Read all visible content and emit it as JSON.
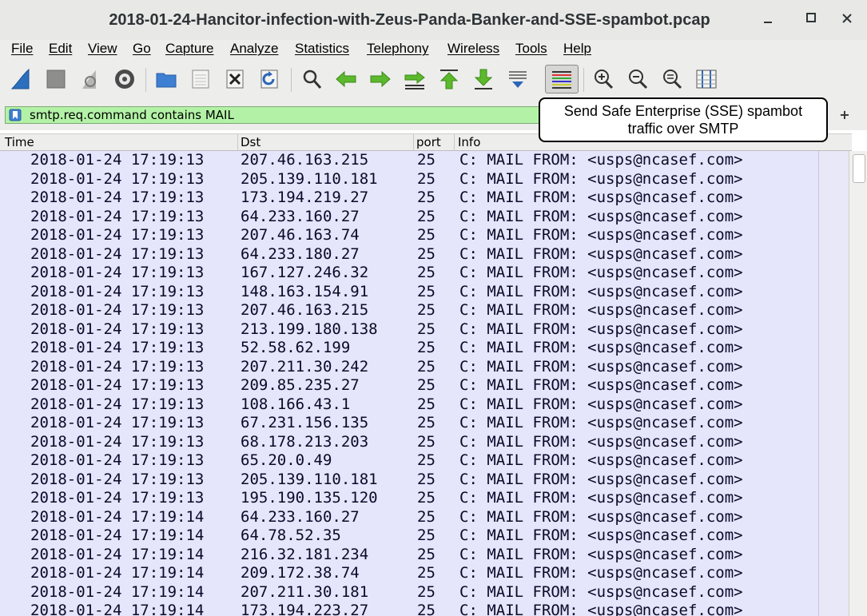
{
  "window": {
    "title": "2018-01-24-Hancitor-infection-with-Zeus-Panda-Banker-and-SSE-spambot.pcap",
    "minimize_label": "_",
    "maximize_label": "■",
    "close_label": "✕"
  },
  "menu": [
    "File",
    "Edit",
    "View",
    "Go",
    "Capture",
    "Analyze",
    "Statistics",
    "Telephony",
    "Wireless",
    "Tools",
    "Help"
  ],
  "toolbar": {
    "icons": [
      "shark-fin-start-icon",
      "stop-capture-icon",
      "restart-capture-icon",
      "capture-options-icon",
      "open-file-icon",
      "save-file-icon",
      "close-file-icon",
      "reload-file-icon",
      "find-packet-icon",
      "go-back-icon",
      "go-forward-icon",
      "go-to-packet-icon",
      "go-first-icon",
      "go-last-icon",
      "autoscroll-icon",
      "colorize-icon",
      "zoom-in-icon",
      "zoom-out-icon",
      "normal-size-icon",
      "resize-columns-icon"
    ]
  },
  "filter": {
    "value": "smtp.req.command contains MAIL",
    "background": "#b3f2a6",
    "add_button_label": "+"
  },
  "callout": {
    "line1": "Send Safe Enterprise (SSE) spambot",
    "line2": "traffic over SMTP"
  },
  "columns": {
    "time": "Time",
    "dst": "Dst",
    "port": "port",
    "info": "Info"
  },
  "rows": [
    {
      "time": "2018-01-24 17:19:13",
      "dst": "207.46.163.215",
      "port": "25",
      "info": "C: MAIL FROM: <usps@ncasef.com>"
    },
    {
      "time": "2018-01-24 17:19:13",
      "dst": "205.139.110.181",
      "port": "25",
      "info": "C: MAIL FROM: <usps@ncasef.com>"
    },
    {
      "time": "2018-01-24 17:19:13",
      "dst": "173.194.219.27",
      "port": "25",
      "info": "C: MAIL FROM: <usps@ncasef.com>"
    },
    {
      "time": "2018-01-24 17:19:13",
      "dst": "64.233.160.27",
      "port": "25",
      "info": "C: MAIL FROM: <usps@ncasef.com>"
    },
    {
      "time": "2018-01-24 17:19:13",
      "dst": "207.46.163.74",
      "port": "25",
      "info": "C: MAIL FROM: <usps@ncasef.com>"
    },
    {
      "time": "2018-01-24 17:19:13",
      "dst": "64.233.180.27",
      "port": "25",
      "info": "C: MAIL FROM: <usps@ncasef.com>"
    },
    {
      "time": "2018-01-24 17:19:13",
      "dst": "167.127.246.32",
      "port": "25",
      "info": "C: MAIL FROM: <usps@ncasef.com>"
    },
    {
      "time": "2018-01-24 17:19:13",
      "dst": "148.163.154.91",
      "port": "25",
      "info": "C: MAIL FROM: <usps@ncasef.com>"
    },
    {
      "time": "2018-01-24 17:19:13",
      "dst": "207.46.163.215",
      "port": "25",
      "info": "C: MAIL FROM: <usps@ncasef.com>"
    },
    {
      "time": "2018-01-24 17:19:13",
      "dst": "213.199.180.138",
      "port": "25",
      "info": "C: MAIL FROM: <usps@ncasef.com>"
    },
    {
      "time": "2018-01-24 17:19:13",
      "dst": "52.58.62.199",
      "port": "25",
      "info": "C: MAIL FROM: <usps@ncasef.com>"
    },
    {
      "time": "2018-01-24 17:19:13",
      "dst": "207.211.30.242",
      "port": "25",
      "info": "C: MAIL FROM: <usps@ncasef.com>"
    },
    {
      "time": "2018-01-24 17:19:13",
      "dst": "209.85.235.27",
      "port": "25",
      "info": "C: MAIL FROM: <usps@ncasef.com>"
    },
    {
      "time": "2018-01-24 17:19:13",
      "dst": "108.166.43.1",
      "port": "25",
      "info": "C: MAIL FROM: <usps@ncasef.com>"
    },
    {
      "time": "2018-01-24 17:19:13",
      "dst": "67.231.156.135",
      "port": "25",
      "info": "C: MAIL FROM: <usps@ncasef.com>"
    },
    {
      "time": "2018-01-24 17:19:13",
      "dst": "68.178.213.203",
      "port": "25",
      "info": "C: MAIL FROM: <usps@ncasef.com>"
    },
    {
      "time": "2018-01-24 17:19:13",
      "dst": "65.20.0.49",
      "port": "25",
      "info": "C: MAIL FROM: <usps@ncasef.com>"
    },
    {
      "time": "2018-01-24 17:19:13",
      "dst": "205.139.110.181",
      "port": "25",
      "info": "C: MAIL FROM: <usps@ncasef.com>"
    },
    {
      "time": "2018-01-24 17:19:13",
      "dst": "195.190.135.120",
      "port": "25",
      "info": "C: MAIL FROM: <usps@ncasef.com>"
    },
    {
      "time": "2018-01-24 17:19:14",
      "dst": "64.233.160.27",
      "port": "25",
      "info": "C: MAIL FROM: <usps@ncasef.com>"
    },
    {
      "time": "2018-01-24 17:19:14",
      "dst": "64.78.52.35",
      "port": "25",
      "info": "C: MAIL FROM: <usps@ncasef.com>"
    },
    {
      "time": "2018-01-24 17:19:14",
      "dst": "216.32.181.234",
      "port": "25",
      "info": "C: MAIL FROM: <usps@ncasef.com>"
    },
    {
      "time": "2018-01-24 17:19:14",
      "dst": "209.172.38.74",
      "port": "25",
      "info": "C: MAIL FROM: <usps@ncasef.com>"
    },
    {
      "time": "2018-01-24 17:19:14",
      "dst": "207.211.30.181",
      "port": "25",
      "info": "C: MAIL FROM: <usps@ncasef.com>"
    },
    {
      "time": "2018-01-24 17:19:14",
      "dst": "173.194.223.27",
      "port": "25",
      "info": "C: MAIL FROM: <usps@ncasef.com>"
    }
  ],
  "colors": {
    "row_background": "#e5e5fb",
    "filter_valid": "#b3f2a6"
  }
}
